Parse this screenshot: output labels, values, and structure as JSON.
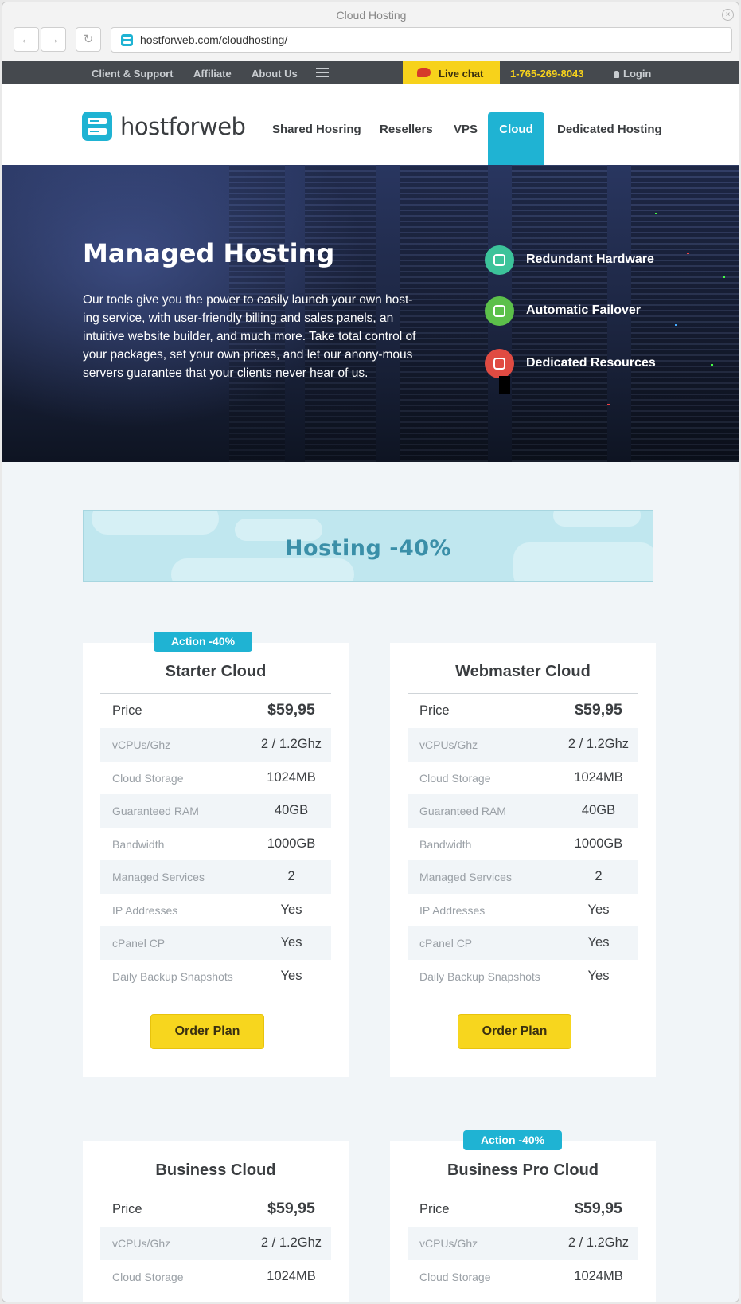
{
  "browser": {
    "title": "Cloud Hosting",
    "url": "hostforweb.com/cloudhosting/",
    "back_icon": "←",
    "forward_icon": "→",
    "reload_icon": "↻",
    "close_icon": "×"
  },
  "topbar": {
    "links": [
      "Client & Support",
      "Affiliate",
      "About Us"
    ],
    "live_chat": "Live chat",
    "phone": "1-765-269-8043",
    "login": "Login"
  },
  "header": {
    "logo": "hostforweb",
    "nav": [
      "Shared Hosring",
      "Resellers",
      "VPS",
      "Cloud",
      "Dedicated Hosting"
    ],
    "active_nav": "Cloud"
  },
  "hero": {
    "title": "Managed Hosting",
    "text": "Our tools give you the power to easily launch your own host-ing service, with user-friendly billing and sales panels, an intuitive website builder, and much more. Take total control of your packages, set your own prices, and let our anony-mous servers guarantee that your clients never hear of us.",
    "features": [
      {
        "label": "Redundant Hardware",
        "color": "#3cc39a",
        "icon": "server-icon"
      },
      {
        "label": "Automatic Failover",
        "color": "#5cc04a",
        "icon": "bandage-icon"
      },
      {
        "label": "Dedicated Resources",
        "color": "#e04b42",
        "icon": "gear-icon"
      }
    ]
  },
  "banner": {
    "text": "Hosting -40%"
  },
  "colors": {
    "accent": "#1fb3d3",
    "button": "#f7d61e",
    "topbar": "#45494e"
  },
  "plans": [
    {
      "action": "Action -40%",
      "name": "Starter Cloud",
      "price_label": "Price",
      "price": "$59,95",
      "specs": [
        {
          "label": "vCPUs/Ghz",
          "value": "2 / 1.2Ghz"
        },
        {
          "label": "Cloud Storage",
          "value": "1024MB"
        },
        {
          "label": "Guaranteed RAM",
          "value": "40GB"
        },
        {
          "label": "Bandwidth",
          "value": "1000GB"
        },
        {
          "label": "Managed Services",
          "value": "2"
        },
        {
          "label": "IP Addresses",
          "value": "Yes"
        },
        {
          "label": "cPanel CP",
          "value": "Yes"
        },
        {
          "label": "Daily Backup Snapshots",
          "value": "Yes"
        }
      ],
      "button": "Order Plan"
    },
    {
      "action": "",
      "name": "Webmaster Cloud",
      "price_label": "Price",
      "price": "$59,95",
      "specs": [
        {
          "label": "vCPUs/Ghz",
          "value": "2 / 1.2Ghz"
        },
        {
          "label": "Cloud Storage",
          "value": "1024MB"
        },
        {
          "label": "Guaranteed RAM",
          "value": "40GB"
        },
        {
          "label": "Bandwidth",
          "value": "1000GB"
        },
        {
          "label": "Managed Services",
          "value": "2"
        },
        {
          "label": "IP Addresses",
          "value": "Yes"
        },
        {
          "label": "cPanel CP",
          "value": "Yes"
        },
        {
          "label": "Daily Backup Snapshots",
          "value": "Yes"
        }
      ],
      "button": "Order Plan"
    },
    {
      "action": "",
      "name": "Business Cloud",
      "price_label": "Price",
      "price": "$59,95",
      "specs": [
        {
          "label": "vCPUs/Ghz",
          "value": "2 / 1.2Ghz"
        },
        {
          "label": "Cloud Storage",
          "value": "1024MB"
        }
      ]
    },
    {
      "action": "Action -40%",
      "name": "Business Pro Cloud",
      "price_label": "Price",
      "price": "$59,95",
      "specs": [
        {
          "label": "vCPUs/Ghz",
          "value": "2 / 1.2Ghz"
        },
        {
          "label": "Cloud Storage",
          "value": "1024MB"
        }
      ]
    }
  ]
}
